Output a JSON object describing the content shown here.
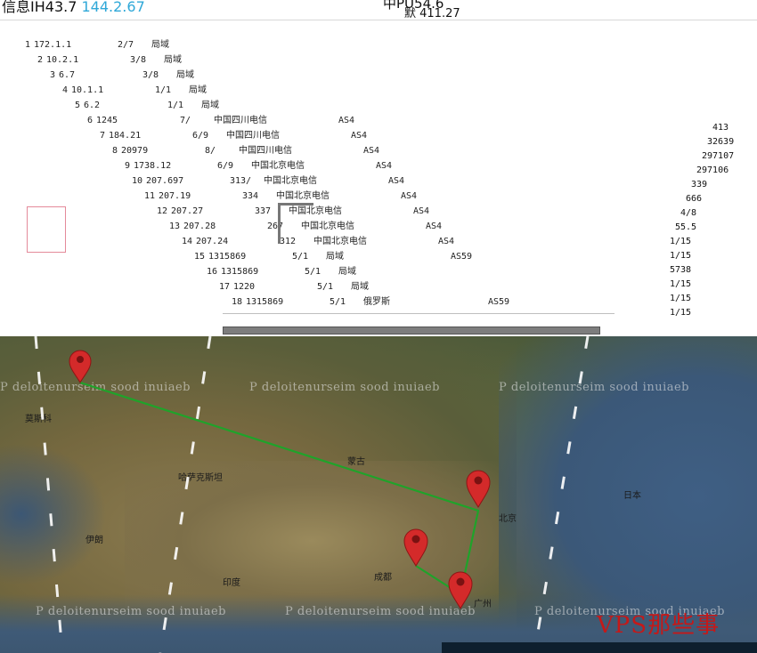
{
  "header": {
    "left_label": "信",
    "left_partial": "息IH43.7",
    "ip": "144.2.67",
    "center_a": "中PU54.6",
    "center_b": "默 411.27"
  },
  "trace": {
    "rows": [
      {
        "hop": "",
        "ip": "",
        "time": "",
        "loc": "",
        "as": ""
      },
      {
        "hop": "1",
        "ip": "172.1.1",
        "time": "2/7",
        "loc": "局域",
        "as": ""
      },
      {
        "hop": "2",
        "ip": "10.2.1",
        "time": "3/8",
        "loc": "局域",
        "as": ""
      },
      {
        "hop": "3",
        "ip": "6.7",
        "time": "3/8",
        "loc": "局域",
        "as": ""
      },
      {
        "hop": "4",
        "ip": "10.1.1",
        "time": "1/1",
        "loc": "局域",
        "as": ""
      },
      {
        "hop": "5",
        "ip": "6.2",
        "time": "1/1",
        "loc": "局域",
        "as": ""
      },
      {
        "hop": "6",
        "ip": "1245",
        "time": "7/",
        "loc": "中国四川电信",
        "as": "AS4"
      },
      {
        "hop": "7",
        "ip": "184.21",
        "time": "6/9",
        "loc": "中国四川电信",
        "as": "AS4"
      },
      {
        "hop": "8",
        "ip": "20979",
        "time": "8/",
        "loc": "中国四川电信",
        "as": "AS4"
      },
      {
        "hop": "9",
        "ip": "1738.12",
        "time": "6/9",
        "loc": "中国北京电信",
        "as": "AS4"
      },
      {
        "hop": "10",
        "ip": "207.697",
        "time": "313/",
        "loc": "中国北京电信",
        "as": "AS4"
      },
      {
        "hop": "11",
        "ip": "207.19",
        "time": "334",
        "loc": "中国北京电信",
        "as": "AS4"
      },
      {
        "hop": "12",
        "ip": "207.27",
        "time": "337",
        "loc": "中国北京电信",
        "as": "AS4"
      },
      {
        "hop": "13",
        "ip": "207.28",
        "time": "267",
        "loc": "中国北京电信",
        "as": "AS4"
      },
      {
        "hop": "14",
        "ip": "207.24",
        "time": "312",
        "loc": "中国北京电信",
        "as": "AS4"
      },
      {
        "hop": "15",
        "ip": "1315869",
        "time": "5/1",
        "loc": "局域",
        "as": "AS59"
      },
      {
        "hop": "16",
        "ip": "1315869",
        "time": "5/1",
        "loc": "局域",
        "as": ""
      },
      {
        "hop": "17",
        "ip": "1220",
        "time": "5/1",
        "loc": "局域",
        "as": ""
      },
      {
        "hop": "18",
        "ip": "1315869",
        "time": "5/1",
        "loc": "俄罗斯",
        "as": "AS59"
      }
    ],
    "right_values": [
      "413",
      "32639",
      "297107",
      "297106",
      "339",
      "666",
      "4/8",
      "55.5",
      "1/15",
      "1/15",
      "5738",
      "1/15",
      "1/15",
      "1/15"
    ]
  },
  "map": {
    "watermark": "P deloitenurseim sood inuiaeb",
    "labels": [
      "莫斯科",
      "哈萨克斯坦",
      "蒙古",
      "北京",
      "成都",
      "广州",
      "日本",
      "印度",
      "伊朗"
    ],
    "brand": "VPS那些事",
    "pins": [
      "moscow-pin",
      "beijing-pin",
      "chengdu-pin",
      "guangzhou-pin"
    ]
  },
  "colors": {
    "route": "#1fa32a",
    "pin": "#d42a2a",
    "ip_accent": "#2fa8d8",
    "brand": "#c41919"
  }
}
